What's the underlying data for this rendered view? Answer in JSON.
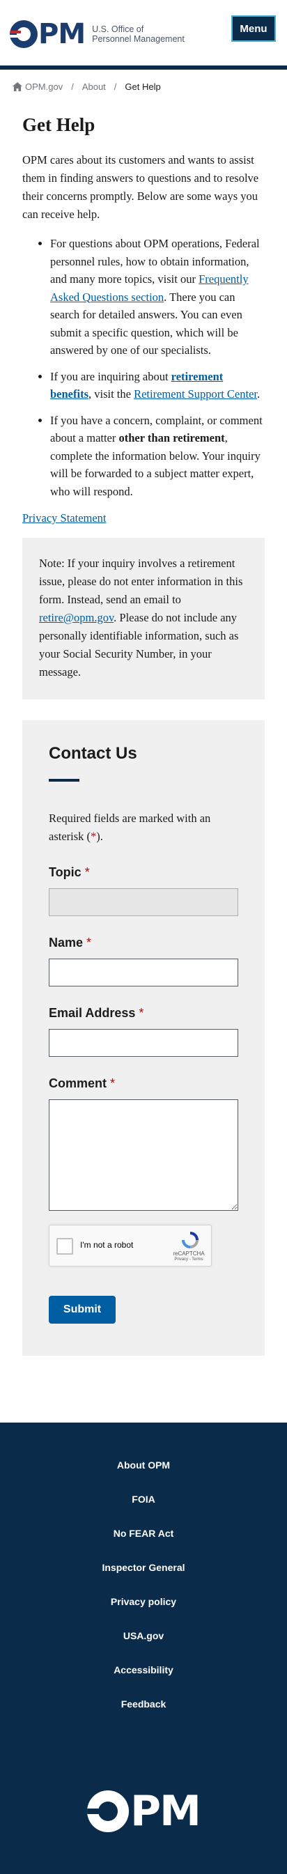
{
  "header": {
    "logo_text": "OPM",
    "logo_line1": "U.S. Office of",
    "logo_line2": "Personnel Management",
    "menu_label": "Menu"
  },
  "breadcrumb": {
    "items": [
      "OPM.gov",
      "About"
    ],
    "current": "Get Help"
  },
  "page": {
    "title": "Get Help",
    "intro": "OPM cares about its customers and wants to assist them in finding answers to questions and to resolve their concerns promptly. Below are some ways you can receive help.",
    "bullet1_pre": "For questions about OPM operations, Federal personnel rules, how to obtain information, and many more topics, visit our ",
    "bullet1_link": "Frequently Asked Questions section",
    "bullet1_post": ". There you can search for detailed answers. You can even submit a specific question, which will be answered by one of our specialists.",
    "bullet2_pre": "If you are inquiring about ",
    "bullet2_link1": "retirement benefits",
    "bullet2_mid": ", visit the ",
    "bullet2_link2": "Retirement Support Center",
    "bullet2_post": ".",
    "bullet3_pre": "If you have a concern, complaint, or comment about a matter ",
    "bullet3_bold": "other than retirement",
    "bullet3_post": ", complete the information below. Your inquiry will be forwarded to a subject matter expert, who will respond.",
    "privacy_link": "Privacy Statement"
  },
  "note": {
    "text_pre": "Note: If your inquiry involves a retirement issue, please do not enter information in this form. Instead, send an email to ",
    "email": "retire@opm.gov",
    "text_post": ". Please do not include any personally identifiable information, such as your Social Security Number, in your message."
  },
  "form": {
    "title": "Contact Us",
    "required_pre": "Required fields are marked with an asterisk (",
    "required_star": "*",
    "required_post": ").",
    "topic_label": "Topic",
    "name_label": "Name",
    "email_label": "Email Address",
    "comment_label": "Comment",
    "star": "*",
    "recaptcha_label": "I'm not a robot",
    "recaptcha_brand": "reCAPTCHA",
    "recaptcha_terms": "Privacy - Terms",
    "submit_label": "Submit"
  },
  "footer": {
    "links": [
      "About OPM",
      "FOIA",
      "No FEAR Act",
      "Inspector General",
      "Privacy policy",
      "USA.gov",
      "Accessibility",
      "Feedback"
    ],
    "logo_text": "OPM"
  },
  "colors": {
    "navy": "#0b2b4a",
    "link": "#005ea2",
    "required": "#b50909",
    "panel": "#f0f0f0"
  }
}
